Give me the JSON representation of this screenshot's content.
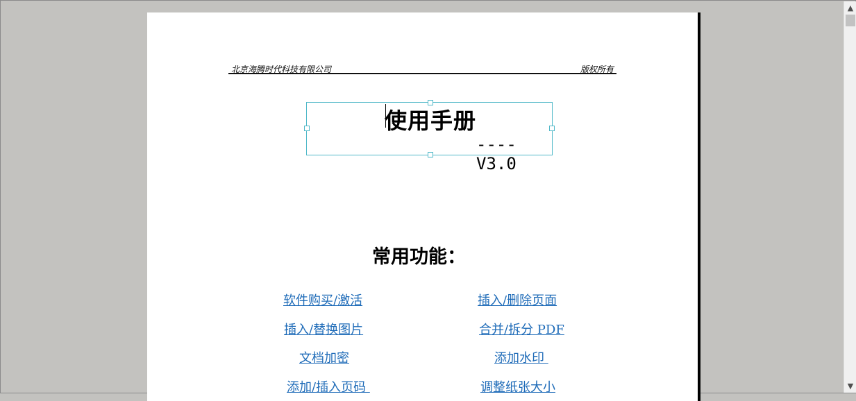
{
  "header": {
    "company": "北京海腾时代科技有限公司",
    "rights": "版权所有"
  },
  "title": {
    "main": "使用手册",
    "version": "----V3.0"
  },
  "features": {
    "heading": "常用功能：",
    "links": [
      "软件购买/激活",
      "插入/删除页面",
      "插入/替换图片",
      "合并/拆分 PDF",
      "文档加密",
      "添加水印 ",
      "添加/插入页码 ",
      "调整纸张大小"
    ]
  },
  "scrollbar": {
    "up_icon": "chevron-up-icon",
    "down_icon": "chevron-down-icon"
  },
  "colors": {
    "link": "#1e6bb8",
    "selection": "#4fb8c8",
    "background": "#c3c2bf"
  }
}
